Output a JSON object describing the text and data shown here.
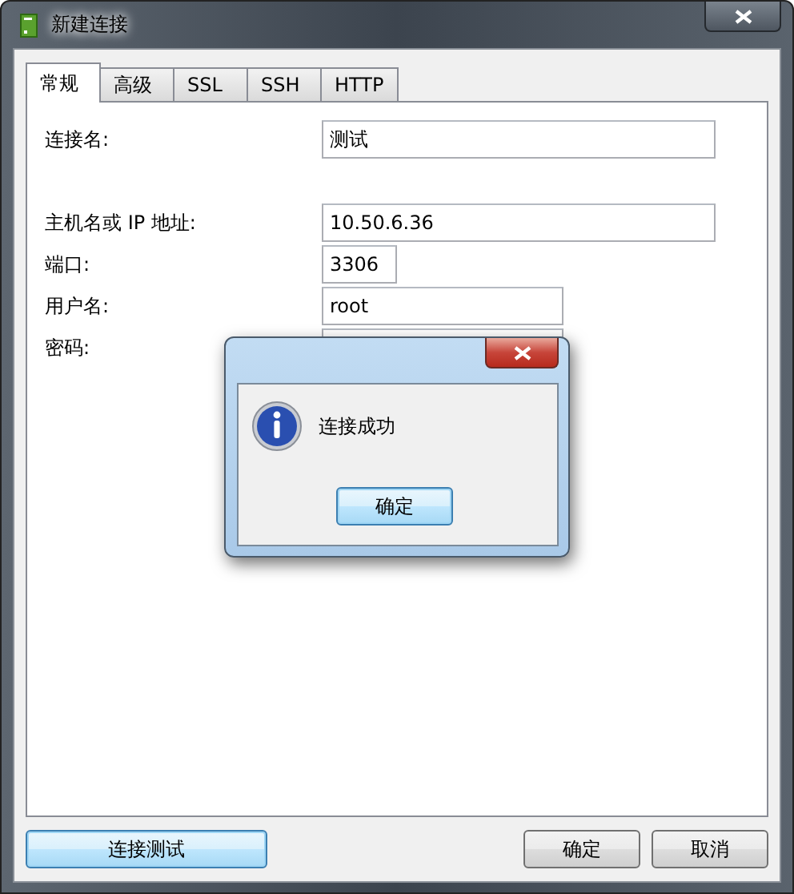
{
  "window": {
    "title": "新建连接"
  },
  "tabs": [
    {
      "label": "常规",
      "selected": true
    },
    {
      "label": "高级",
      "selected": false
    },
    {
      "label": "SSL",
      "selected": false
    },
    {
      "label": "SSH",
      "selected": false
    },
    {
      "label": "HTTP",
      "selected": false
    }
  ],
  "form_groups": [
    [
      {
        "label": "连接名:",
        "value": "测试"
      }
    ],
    [
      {
        "label": "主机名或 IP 地址:",
        "value": "10.50.6.36"
      },
      {
        "label": "端口:",
        "value": "3306"
      },
      {
        "label": "用户名:",
        "value": "root"
      },
      {
        "label": "密码:"
      }
    ]
  ],
  "left_buttons": [
    {
      "label": "连接测试",
      "focused": true
    }
  ],
  "right_buttons": [
    {
      "label": "确定",
      "focused": false
    },
    {
      "label": "取消",
      "focused": false
    }
  ],
  "message_box": {
    "message": "连接成功",
    "button": {
      "label": "确定",
      "focused": true
    }
  }
}
